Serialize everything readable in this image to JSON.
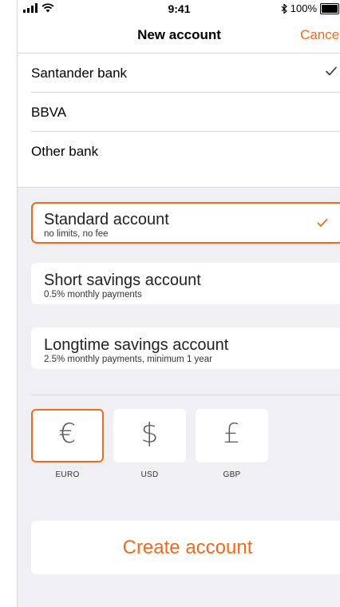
{
  "status": {
    "time": "9:41",
    "battery": "100%",
    "battery_level": 1.0
  },
  "nav": {
    "title": "New account",
    "cancel": "Cancel"
  },
  "banks": [
    {
      "label": "Santander bank",
      "selected": true
    },
    {
      "label": "BBVA",
      "selected": false
    },
    {
      "label": "Other bank",
      "selected": false
    }
  ],
  "accounts": [
    {
      "name": "Standard account",
      "desc": "no limits, no fee",
      "selected": true
    },
    {
      "name": "Short savings account",
      "desc": "0.5% monthly payments",
      "selected": false
    },
    {
      "name": "Longtime savings account",
      "desc": "2.5% monthly payments, minimum 1 year",
      "selected": false
    }
  ],
  "currencies": [
    {
      "symbol": "€",
      "label": "EURO",
      "selected": true
    },
    {
      "symbol": "$",
      "label": "USD",
      "selected": false
    },
    {
      "symbol": "£",
      "label": "GBP",
      "selected": false
    }
  ],
  "create_button": "Create account",
  "colors": {
    "accent": "#f26a1b",
    "background": "#efeff4"
  }
}
